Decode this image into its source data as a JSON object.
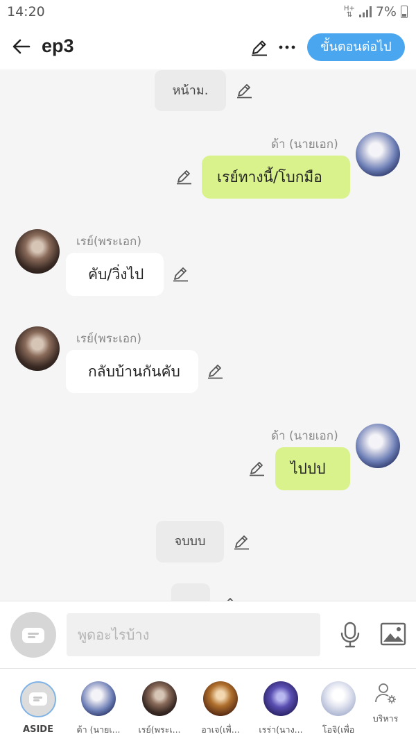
{
  "status_bar": {
    "time": "14:20",
    "network": "H+",
    "battery": "7%"
  },
  "header": {
    "title": "ep3",
    "next_button": "ขั้นตอนต่อไป"
  },
  "messages": [
    {
      "type": "narration",
      "text": "หน้าม."
    },
    {
      "type": "right",
      "speaker": "ด้า (นายเอก)",
      "text": "เรย์ทางนี้/โบกมือ"
    },
    {
      "type": "left",
      "speaker": "เรย์(พระเอก)",
      "text": "คับ/วิ่งไป"
    },
    {
      "type": "left",
      "speaker": "เรย์(พระเอก)",
      "text": "กลับบ้านกันคับ"
    },
    {
      "type": "right",
      "speaker": "ด้า (นายเอก)",
      "text": "ไปปป"
    },
    {
      "type": "narration",
      "text": "จบบบ"
    }
  ],
  "input": {
    "placeholder": "พูดอะไรบ้าง"
  },
  "characters": [
    {
      "label": "ASIDE"
    },
    {
      "label": "ด้า (นายเ..."
    },
    {
      "label": "เรย์(พระเ..."
    },
    {
      "label": "อาเจ(เพื่..."
    },
    {
      "label": "เรร่า(นาง..."
    },
    {
      "label": "โอจิ(เพื่อ"
    },
    {
      "label": "บริหาร"
    }
  ],
  "colors": {
    "accent": "#4aa7ef",
    "right_bubble": "#d9f28c",
    "left_bubble": "#ffffff",
    "narration": "#ebebeb"
  }
}
